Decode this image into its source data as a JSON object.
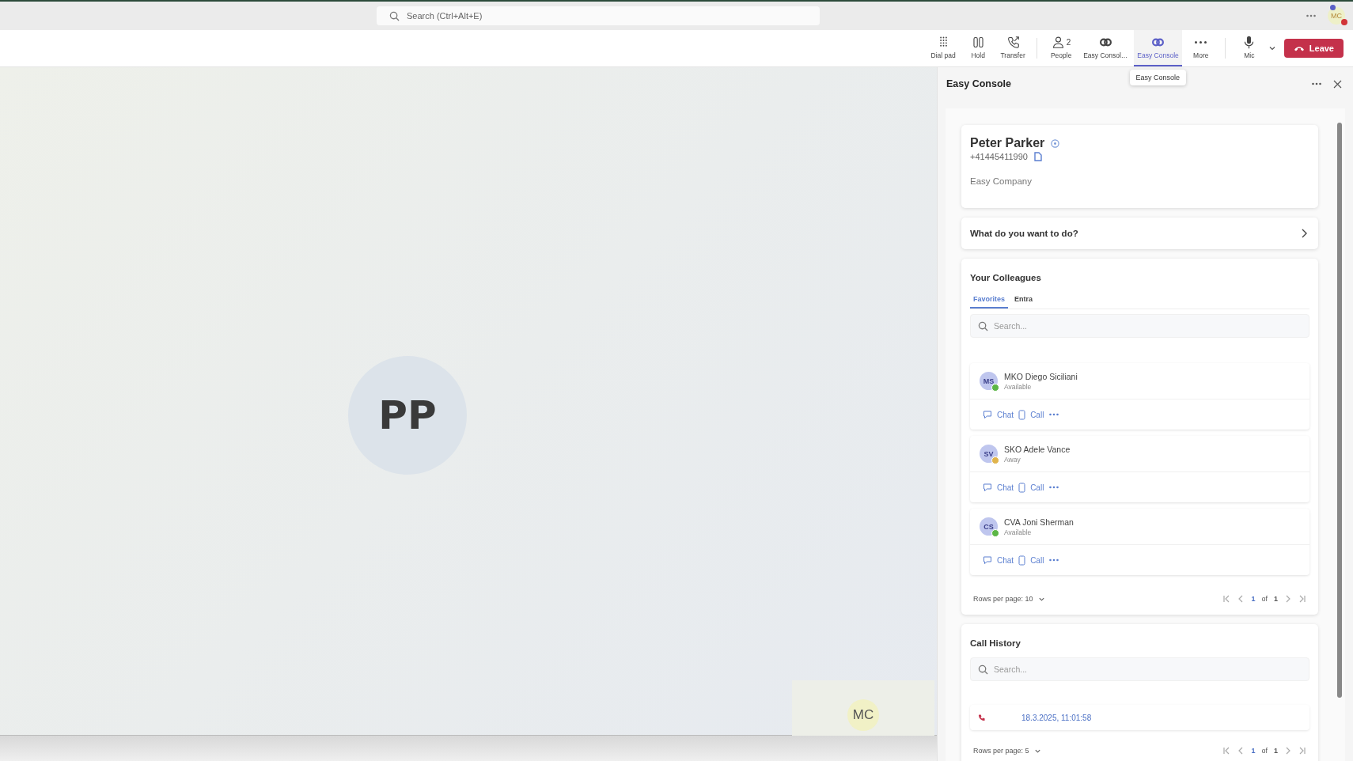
{
  "title_bar": {
    "search": {
      "placeholder": "Search (Ctrl+Alt+E)"
    },
    "avatar": "MC"
  },
  "toolbar": {
    "buttons": [
      {
        "kind": "dialpad",
        "label": "Dial pad",
        "selected": false
      },
      {
        "kind": "hold",
        "label": "Hold",
        "selected": false
      },
      {
        "kind": "transfer",
        "label": "Transfer",
        "selected": false
      },
      {
        "kind": "people",
        "label": "People",
        "count": "2",
        "selected": false
      },
      {
        "kind": "console",
        "label": "Easy Consol…",
        "selected": false
      },
      {
        "kind": "console",
        "label": "Easy Console",
        "selected": true
      },
      {
        "kind": "more",
        "label": "More",
        "selected": false
      },
      {
        "kind": "mic",
        "label": "Mic",
        "selected": false
      }
    ],
    "leave": "Leave",
    "tooltip": "Easy Console"
  },
  "stage": {
    "participant": "PP",
    "self_view": "MC"
  },
  "panel": {
    "title": "Easy Console",
    "contact": {
      "name": "Peter Parker",
      "phone": "+41445411990",
      "company": "Easy Company"
    },
    "action_prompt": "What do you want to do?",
    "colleagues": {
      "title": "Your Colleagues",
      "tabs": [
        {
          "label": "Favorites",
          "selected": true
        },
        {
          "label": "Entra",
          "selected": false
        }
      ],
      "search": {
        "placeholder": "Search..."
      },
      "items": [
        {
          "initials": "MS",
          "name": "MKO Diego Siciliani",
          "status": "Available",
          "color": "#5cb646",
          "chat": "Chat",
          "call": "Call"
        },
        {
          "initials": "SV",
          "name": "SKO Adele Vance",
          "status": "Away",
          "color": "#e0b44c",
          "chat": "Chat",
          "call": "Call"
        },
        {
          "initials": "CS",
          "name": "CVA Joni Sherman",
          "status": "Available",
          "color": "#5cb646",
          "chat": "Chat",
          "call": "Call"
        }
      ],
      "pagination": {
        "rows_per_page": "Rows per page: 10",
        "page": "1",
        "of": "of",
        "total": "1"
      }
    },
    "call_history": {
      "title": "Call History",
      "search": {
        "placeholder": "Search..."
      },
      "rows": [
        {
          "kind": "missed",
          "time": "18.3.2025, 11:01:58"
        }
      ],
      "pagination": {
        "rows_per_page": "Rows per page: 5",
        "page": "1",
        "of": "of",
        "total": "1"
      }
    }
  }
}
